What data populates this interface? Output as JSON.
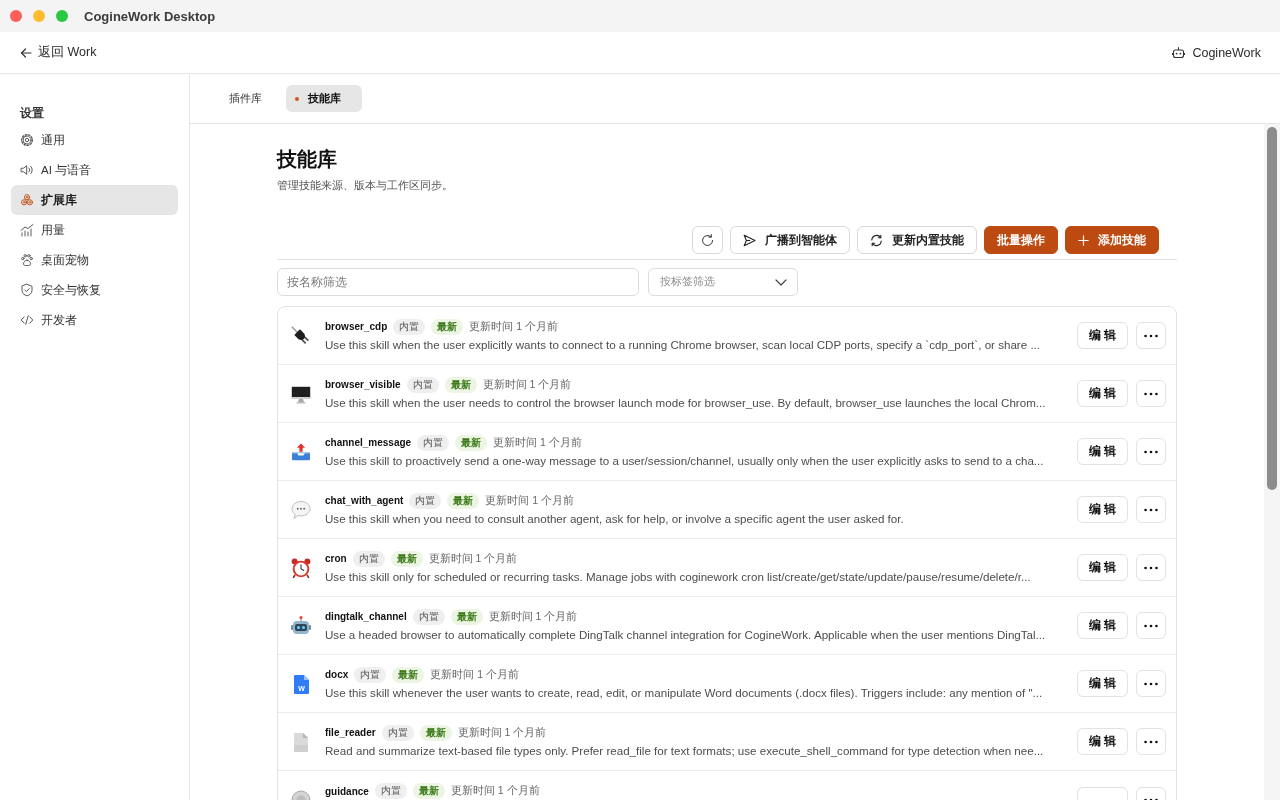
{
  "window": {
    "title": "CogineWork Desktop"
  },
  "header": {
    "back_link": "返回 Work",
    "agent": "CogineWork"
  },
  "sidebar": {
    "heading": "设置",
    "items": [
      {
        "label": "通用",
        "selected": false
      },
      {
        "label": "AI 与语音",
        "selected": false
      },
      {
        "label": "扩展库",
        "selected": true
      },
      {
        "label": "用量",
        "selected": false
      },
      {
        "label": "桌面宠物",
        "selected": false
      },
      {
        "label": "安全与恢复",
        "selected": false
      },
      {
        "label": "开发者",
        "selected": false
      }
    ]
  },
  "tabs": [
    {
      "label": "插件库",
      "selected": false
    },
    {
      "label": "技能库",
      "selected": true
    }
  ],
  "page": {
    "title": "技能库",
    "subtitle": "管理技能来源、版本与工作区同步。"
  },
  "toolbar": {
    "buttons": [
      {
        "label": "广播到智能体",
        "kind": "secondary"
      },
      {
        "label": "更新内置技能",
        "kind": "secondary"
      },
      {
        "label": "批量操作",
        "kind": "primary"
      },
      {
        "label": "添加技能",
        "kind": "primary"
      }
    ]
  },
  "filters": {
    "name_filter": {
      "placeholder": "按名称筛选"
    },
    "tag_filter": {
      "placeholder": "按标签筛选"
    }
  },
  "skills": [
    {
      "name": "browser_cdp",
      "badges": [
        {
          "label": "内置",
          "kind": "builtin"
        },
        {
          "label": "最新",
          "kind": "latest"
        }
      ],
      "updated": "更新时间 1 个月前",
      "description": "Use this skill when the user explicitly wants to connect to a running Chrome browser, scan local CDP ports, specify a `cdp_port`, or share ...",
      "edit_label": "编 辑"
    },
    {
      "name": "browser_visible",
      "badges": [
        {
          "label": "内置",
          "kind": "builtin"
        },
        {
          "label": "最新",
          "kind": "latest"
        }
      ],
      "updated": "更新时间 1 个月前",
      "description": "Use this skill when the user needs to control the browser launch mode for browser_use. By default, browser_use launches the local Chrom...",
      "edit_label": "编 辑"
    },
    {
      "name": "channel_message",
      "badges": [
        {
          "label": "内置",
          "kind": "builtin"
        },
        {
          "label": "最新",
          "kind": "latest"
        }
      ],
      "updated": "更新时间 1 个月前",
      "description": "Use this skill to proactively send a one-way message to a user/session/channel, usually only when the user explicitly asks to send to a cha...",
      "edit_label": "编 辑"
    },
    {
      "name": "chat_with_agent",
      "badges": [
        {
          "label": "内置",
          "kind": "builtin"
        },
        {
          "label": "最新",
          "kind": "latest"
        }
      ],
      "updated": "更新时间 1 个月前",
      "description": "Use this skill when you need to consult another agent, ask for help, or involve a specific agent the user asked for.",
      "edit_label": "编 辑"
    },
    {
      "name": "cron",
      "badges": [
        {
          "label": "内置",
          "kind": "builtin"
        },
        {
          "label": "最新",
          "kind": "latest"
        }
      ],
      "updated": "更新时间 1 个月前",
      "description": "Use this skill only for scheduled or recurring tasks. Manage jobs with coginework cron list/create/get/state/update/pause/resume/delete/r...",
      "edit_label": "编 辑"
    },
    {
      "name": "dingtalk_channel",
      "badges": [
        {
          "label": "内置",
          "kind": "builtin"
        },
        {
          "label": "最新",
          "kind": "latest"
        }
      ],
      "updated": "更新时间 1 个月前",
      "description": "Use a headed browser to automatically complete DingTalk channel integration for CogineWork. Applicable when the user mentions DingTal...",
      "edit_label": "编 辑"
    },
    {
      "name": "docx",
      "icon_letter": "W",
      "badges": [
        {
          "label": "内置",
          "kind": "builtin"
        },
        {
          "label": "最新",
          "kind": "latest"
        }
      ],
      "updated": "更新时间 1 个月前",
      "description": "Use this skill whenever the user wants to create, read, edit, or manipulate Word documents (.docx files). Triggers include: any mention of \"...",
      "edit_label": "编 辑"
    },
    {
      "name": "file_reader",
      "badges": [
        {
          "label": "内置",
          "kind": "builtin"
        },
        {
          "label": "最新",
          "kind": "latest"
        }
      ],
      "updated": "更新时间 1 个月前",
      "description": "Read and summarize text-based file types only. Prefer read_file for text formats; use execute_shell_command for type detection when nee...",
      "edit_label": "编 辑"
    },
    {
      "name": "guidance",
      "badges": [
        {
          "label": "内置",
          "kind": "builtin"
        },
        {
          "label": "最新",
          "kind": "latest"
        }
      ],
      "updated": "更新时间 1 个月前"
    }
  ]
}
